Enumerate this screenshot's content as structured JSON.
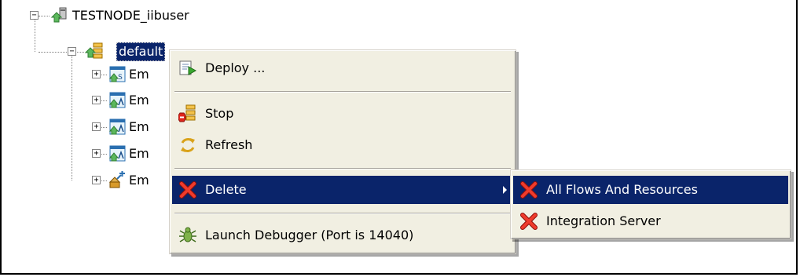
{
  "tree": {
    "root": {
      "label": "TESTNODE_iibuser",
      "icon": "integration-node-icon"
    },
    "server": {
      "label": "default",
      "icon": "integration-server-icon"
    },
    "children": [
      {
        "label": "Em",
        "icon": "shared-library-icon"
      },
      {
        "label": "Em",
        "icon": "application-icon"
      },
      {
        "label": "Em",
        "icon": "application-icon"
      },
      {
        "label": "Em",
        "icon": "application-icon"
      },
      {
        "label": "Em",
        "icon": "service-icon"
      }
    ]
  },
  "context_menu": {
    "items": [
      {
        "label": "Deploy ...",
        "icon": "deploy-icon"
      },
      {
        "label": "Stop",
        "icon": "stop-icon"
      },
      {
        "label": "Refresh",
        "icon": "refresh-icon"
      },
      {
        "label": "Delete",
        "icon": "delete-icon",
        "has_submenu": true,
        "highlighted": true
      },
      {
        "label": "Launch Debugger (Port is 14040)",
        "icon": "debugger-icon"
      }
    ]
  },
  "submenu": {
    "items": [
      {
        "label": "All Flows And Resources",
        "icon": "delete-icon",
        "highlighted": true
      },
      {
        "label": "Integration Server",
        "icon": "delete-icon"
      }
    ]
  },
  "colors": {
    "selection": "#0a246a",
    "menu_background": "#f1efe2",
    "delete_red": "#e0261c"
  }
}
